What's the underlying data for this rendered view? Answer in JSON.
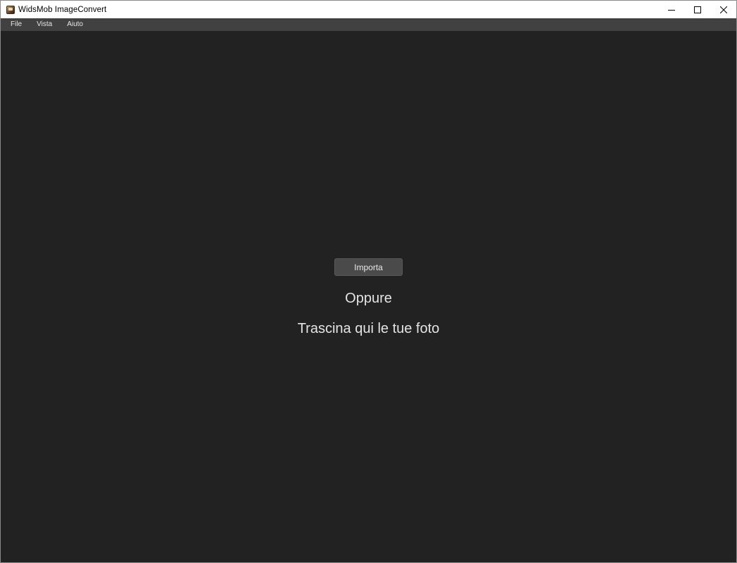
{
  "window": {
    "title": "WidsMob ImageConvert"
  },
  "window_controls": {
    "minimize_icon": "minimize-icon",
    "maximize_icon": "maximize-icon",
    "close_icon": "close-icon"
  },
  "menubar": {
    "items": [
      {
        "label": "File"
      },
      {
        "label": "Vista"
      },
      {
        "label": "Aiuto"
      }
    ]
  },
  "main": {
    "import_button": "Importa",
    "or_text": "Oppure",
    "drop_text": "Trascina qui le tue foto"
  },
  "colors": {
    "background": "#222222",
    "menubar": "#414141",
    "button": "#4a4a4a",
    "text": "#e4e4e4"
  }
}
